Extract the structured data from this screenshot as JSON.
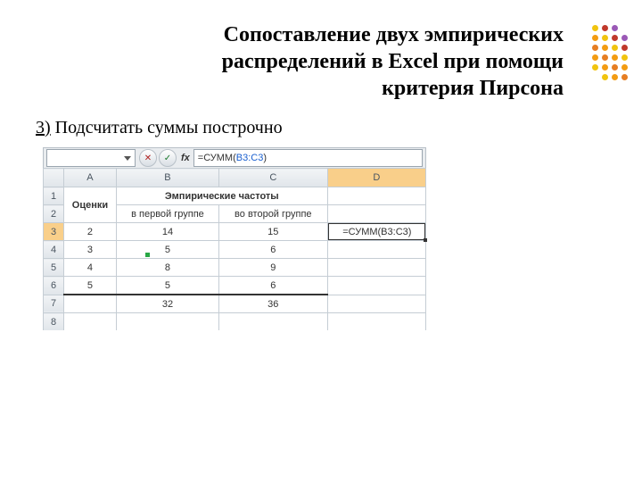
{
  "title_l1": "Сопоставление двух эмпирических",
  "title_l2": "распределений в Excel при помощи",
  "title_l3": "критерия Пирсона",
  "bullet_num": "3)",
  "bullet_text": " Подсчитать  суммы построчно",
  "fx": {
    "label": "fx",
    "prefix": "=СУММ(",
    "range": "B3:C3",
    "suffix": ")",
    "cancel": "✕",
    "confirm": "✓"
  },
  "cols": [
    "",
    "A",
    "B",
    "C",
    "D"
  ],
  "rowheads": [
    "1",
    "2",
    "3",
    "4",
    "5",
    "6",
    "7",
    "8"
  ],
  "headers": {
    "ocenki": "Оценки",
    "emp": "Эмпирические частоты",
    "g1": "в первой группе",
    "g2": "во второй группе"
  },
  "d_formula": "=СУММ(B3:C3)",
  "chart_data": {
    "type": "table",
    "columns": [
      "Оценки",
      "в первой группе",
      "во второй группе"
    ],
    "rows": [
      [
        2,
        14,
        15
      ],
      [
        3,
        5,
        6
      ],
      [
        4,
        8,
        9
      ],
      [
        5,
        5,
        6
      ]
    ],
    "totals": {
      "в первой группе": 32,
      "во второй группе": 36
    }
  },
  "deco_colors": [
    "#f1c40f",
    "#c0392b",
    "#9b59b6",
    "",
    "#f39c12",
    "#f1c40f",
    "#c0392b",
    "#9b59b6",
    "#e67e22",
    "#f39c12",
    "#f1c40f",
    "#c0392b",
    "#f39c12",
    "#e67e22",
    "#f39c12",
    "#f1c40f",
    "#f1c40f",
    "#f39c12",
    "#e67e22",
    "#f39c12",
    "",
    "#f1c40f",
    "#f39c12",
    "#e67e22"
  ]
}
